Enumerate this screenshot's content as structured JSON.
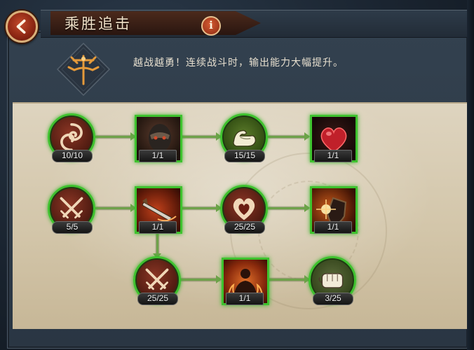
{
  "header": {
    "title": "乘胜追击",
    "back_icon": "back-arrow-icon",
    "info_label": "i"
  },
  "description": "越战越勇！连续战斗时，输出能力大幅提升。",
  "colors": {
    "active_border": "#3ec22e",
    "connector": "#6fa24a",
    "parchment": "#d9ceb6",
    "title_text": "#f0e1c8"
  },
  "nodes": [
    {
      "id": "r1c1",
      "icon": "swirl-icon",
      "progress": "10/10"
    },
    {
      "id": "r1c2",
      "icon": "masked-warrior-icon",
      "progress": "1/1"
    },
    {
      "id": "r1c3",
      "icon": "flexing-arm-icon",
      "progress": "15/15"
    },
    {
      "id": "r1c4",
      "icon": "heart-icon",
      "progress": "1/1"
    },
    {
      "id": "r2c1",
      "icon": "crossed-swords-icon",
      "progress": "5/5"
    },
    {
      "id": "r2c2",
      "icon": "sword-slash-icon",
      "progress": "1/1"
    },
    {
      "id": "r2c3",
      "icon": "heart-emblem-icon",
      "progress": "25/25"
    },
    {
      "id": "r2c4",
      "icon": "shield-spark-icon",
      "progress": "1/1"
    },
    {
      "id": "r3c2",
      "icon": "crossed-swords-icon",
      "progress": "25/25"
    },
    {
      "id": "r3c3",
      "icon": "fire-warrior-icon",
      "progress": "1/1"
    },
    {
      "id": "r3c4",
      "icon": "fist-icon",
      "progress": "3/25"
    }
  ]
}
